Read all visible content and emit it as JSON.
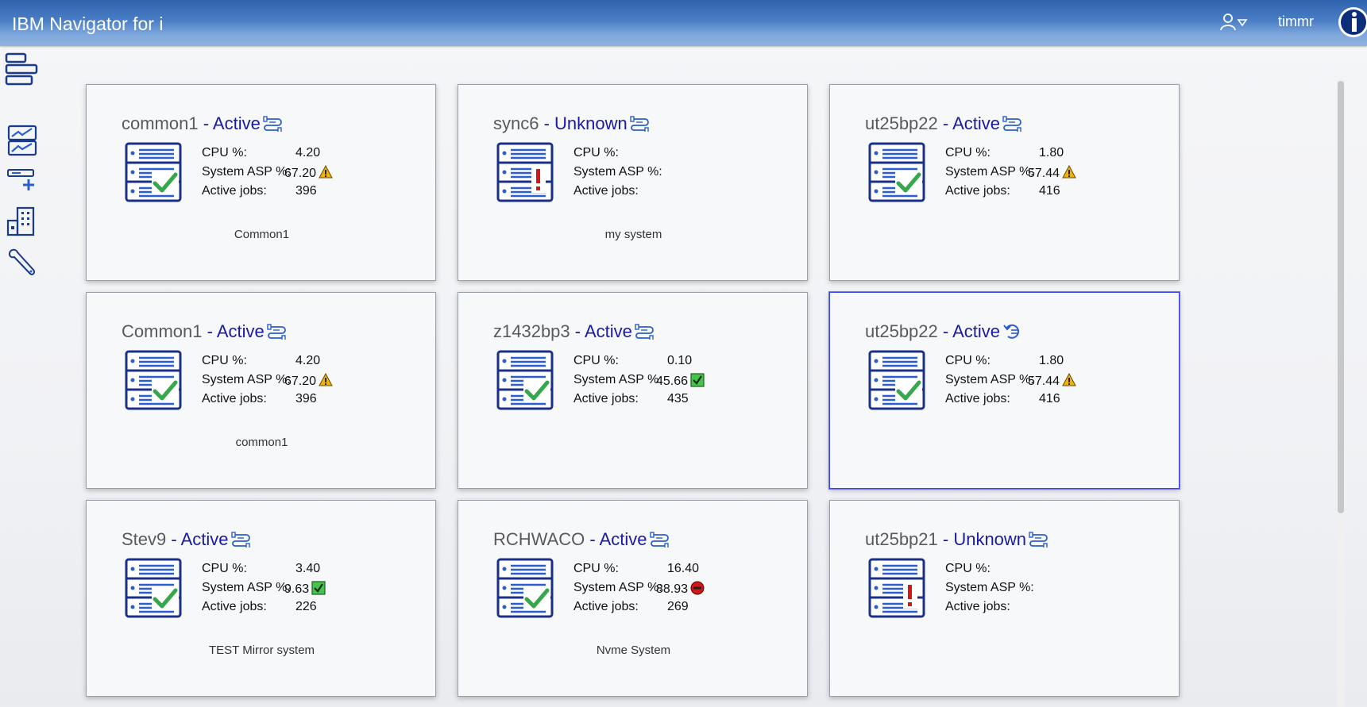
{
  "header": {
    "title": "IBM Navigator for i",
    "username": "timmr",
    "user_menu_icon": "user-dropdown-icon",
    "logo_icon": "ibm-i-logo-icon"
  },
  "sidebar": {
    "items": [
      {
        "name": "sidebar-item-dashboard",
        "icon": "dashboard-icon"
      },
      {
        "name": "sidebar-item-monitors",
        "icon": "chart-monitor-icon"
      },
      {
        "name": "sidebar-item-add-system",
        "icon": "add-system-icon"
      },
      {
        "name": "sidebar-item-systems",
        "icon": "building-icon"
      },
      {
        "name": "sidebar-item-tools",
        "icon": "wrench-icon"
      }
    ]
  },
  "labels": {
    "cpu": "CPU %:",
    "asp": "System ASP %:",
    "jobs": "Active jobs:"
  },
  "colors": {
    "status_text": "#1a1aa6",
    "ok_green": "#36a84c",
    "error_red": "#d01818",
    "warning_yellow": "#f0b400",
    "selected_border": "#3a43f0"
  },
  "cards": [
    {
      "name": "common1",
      "status": " - Active",
      "cpu": "4.20",
      "asp": "67.20",
      "asp_state": "warning",
      "jobs": "396",
      "description": "Common1",
      "health": "ok",
      "conn": "connected"
    },
    {
      "name": "sync6",
      "status": " - Unknown",
      "cpu": "",
      "asp": "",
      "asp_state": "none",
      "jobs": "",
      "description": "my system",
      "health": "error",
      "conn": "connected"
    },
    {
      "name": "ut25bp22",
      "status": " - Active",
      "cpu": "1.80",
      "asp": "57.44",
      "asp_state": "warning",
      "jobs": "416",
      "description": "",
      "health": "ok",
      "conn": "connected"
    },
    {
      "name": "Common1",
      "status": " - Active",
      "cpu": "4.20",
      "asp": "67.20",
      "asp_state": "warning",
      "jobs": "396",
      "description": "common1",
      "health": "ok",
      "conn": "connected"
    },
    {
      "name": "z1432bp3",
      "status": " - Active",
      "cpu": "0.10",
      "asp": "45.66",
      "asp_state": "ok",
      "jobs": "435",
      "description": "",
      "health": "ok",
      "conn": "connected"
    },
    {
      "name": "ut25bp22",
      "status": " - Active",
      "cpu": "1.80",
      "asp": "57.44",
      "asp_state": "warning",
      "jobs": "416",
      "description": "",
      "health": "ok",
      "conn": "refresh",
      "selected": true
    },
    {
      "name": "Stev9",
      "status": " - Active",
      "cpu": "3.40",
      "asp": "9.63",
      "asp_state": "ok",
      "jobs": "226",
      "description": "TEST Mirror system",
      "health": "ok",
      "conn": "connected"
    },
    {
      "name": "RCHWACO",
      "status": " - Active",
      "cpu": "16.40",
      "asp": "88.93",
      "asp_state": "critical",
      "jobs": "269",
      "description": "Nvme System",
      "health": "ok",
      "conn": "connected"
    },
    {
      "name": "ut25bp21",
      "status": " - Unknown",
      "cpu": "",
      "asp": "",
      "asp_state": "none",
      "jobs": "",
      "description": "",
      "health": "error",
      "conn": "connected"
    }
  ]
}
